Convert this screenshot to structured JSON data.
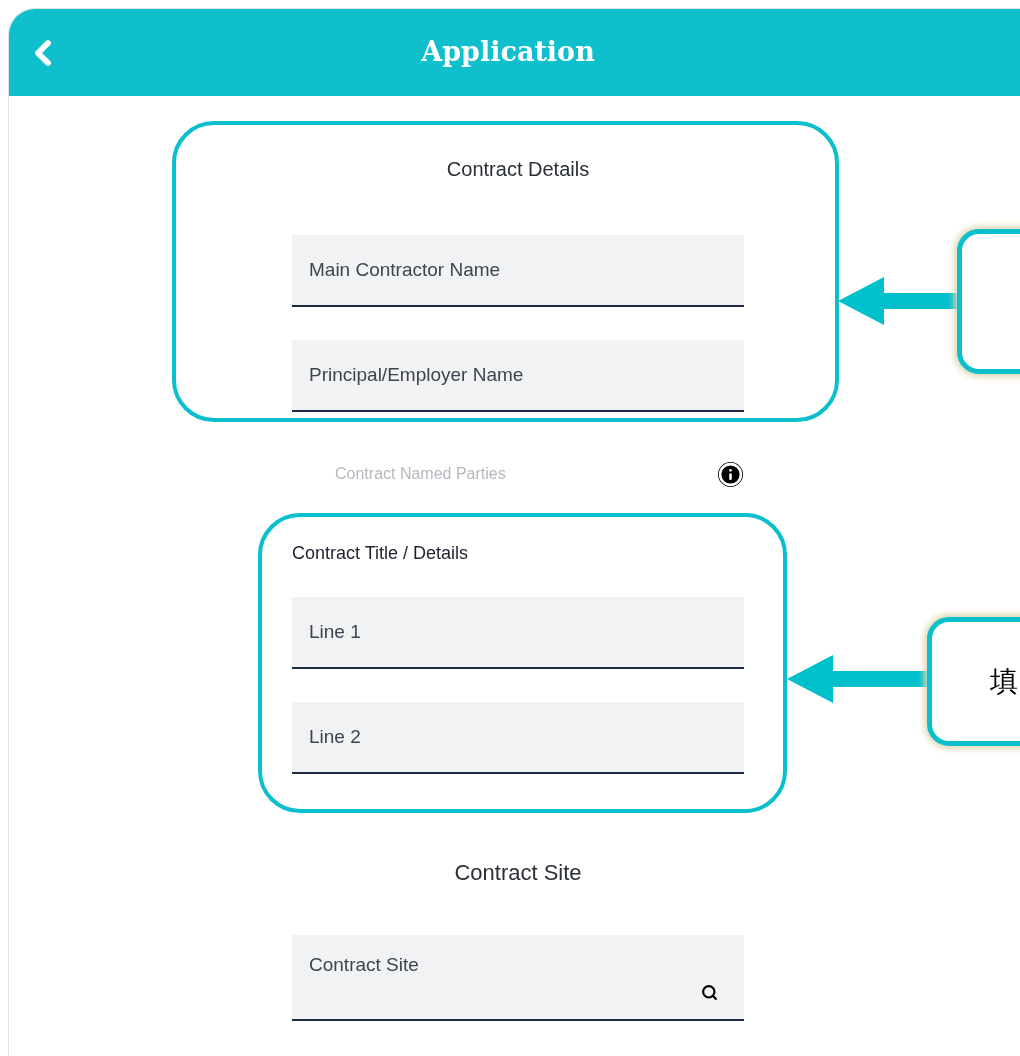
{
  "header": {
    "title": "Application"
  },
  "contract_details": {
    "title": "Contract Details",
    "fields": [
      {
        "placeholder": "Main Contractor Name"
      },
      {
        "placeholder": "Principal/Employer Name"
      }
    ]
  },
  "named_parties": {
    "label": "Contract Named Parties"
  },
  "contract_title": {
    "label": "Contract Title / Details",
    "fields": [
      {
        "placeholder": "Line 1"
      },
      {
        "placeholder": "Line 2"
      }
    ]
  },
  "contract_site": {
    "title": "Contract Site",
    "field": {
      "placeholder": "Contract Site"
    }
  },
  "callouts": [
    {
      "kind": "empty"
    },
    {
      "kind": "text",
      "text": "填"
    }
  ]
}
